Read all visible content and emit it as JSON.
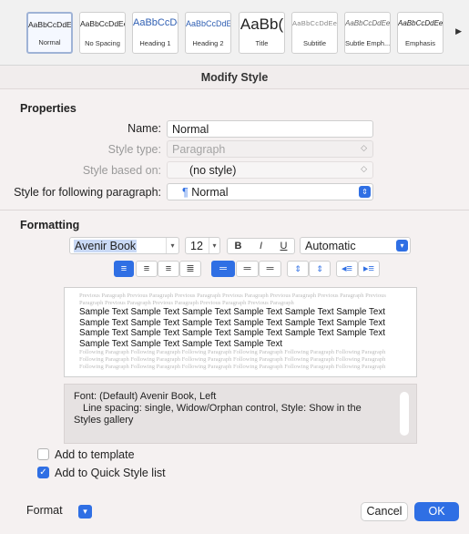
{
  "gallery": {
    "tiles": [
      {
        "sample": "AaBbCcDdEe",
        "name": "Normal"
      },
      {
        "sample": "AaBbCcDdEe",
        "name": "No Spacing"
      },
      {
        "sample": "AaBbCcDc",
        "name": "Heading 1"
      },
      {
        "sample": "AaBbCcDdEe",
        "name": "Heading 2"
      },
      {
        "sample": "AaBb(",
        "name": "Title"
      },
      {
        "sample": "AaBbCcDdEe",
        "name": "Subtitle"
      },
      {
        "sample": "AaBbCcDdEe",
        "name": "Subtle Emph..."
      },
      {
        "sample": "AaBbCcDdEe",
        "name": "Emphasis"
      }
    ],
    "more_icon": "triangle-right-icon"
  },
  "dialog": {
    "title": "Modify Style",
    "properties": {
      "heading": "Properties",
      "name_label": "Name:",
      "name_value": "Normal",
      "style_type_label": "Style type:",
      "style_type_value": "Paragraph",
      "based_on_label": "Style based on:",
      "based_on_value": "(no style)",
      "following_label": "Style for following paragraph:",
      "following_glyph": "¶",
      "following_value": "Normal"
    },
    "formatting": {
      "heading": "Formatting",
      "font": "Avenir Book",
      "size": "12",
      "bold": "B",
      "italic": "I",
      "underline": "U",
      "color": "Automatic"
    },
    "preview": {
      "before": [
        "Previous Paragraph Previous Paragraph Previous Paragraph Previous Paragraph Previous Paragraph Previous Paragraph Previous",
        "Paragraph Previous Paragraph Previous Paragraph Previous Paragraph Previous Paragraph"
      ],
      "sample": [
        "Sample Text Sample Text Sample Text Sample Text Sample Text Sample Text",
        "Sample Text Sample Text Sample Text Sample Text Sample Text Sample Text",
        "Sample Text Sample Text Sample Text Sample Text Sample Text Sample Text",
        "Sample Text Sample Text Sample Text Sample Text"
      ],
      "after": [
        "Following Paragraph Following Paragraph Following Paragraph Following Paragraph Following Paragraph Following Paragraph",
        "Following Paragraph Following Paragraph Following Paragraph Following Paragraph Following Paragraph Following Paragraph",
        "Following Paragraph Following Paragraph Following Paragraph Following Paragraph Following Paragraph Following Paragraph"
      ]
    },
    "description": {
      "line1": "Font: (Default) Avenir Book, Left",
      "line2": "Line spacing:  single, Widow/Orphan control, Style: Show in the",
      "line3": "Styles gallery"
    },
    "add_to_template": "Add to template",
    "add_to_quick_style": "Add to Quick Style list",
    "format_label": "Format",
    "cancel_label": "Cancel",
    "ok_label": "OK"
  },
  "colors": {
    "accent": "#2f6fe4"
  }
}
